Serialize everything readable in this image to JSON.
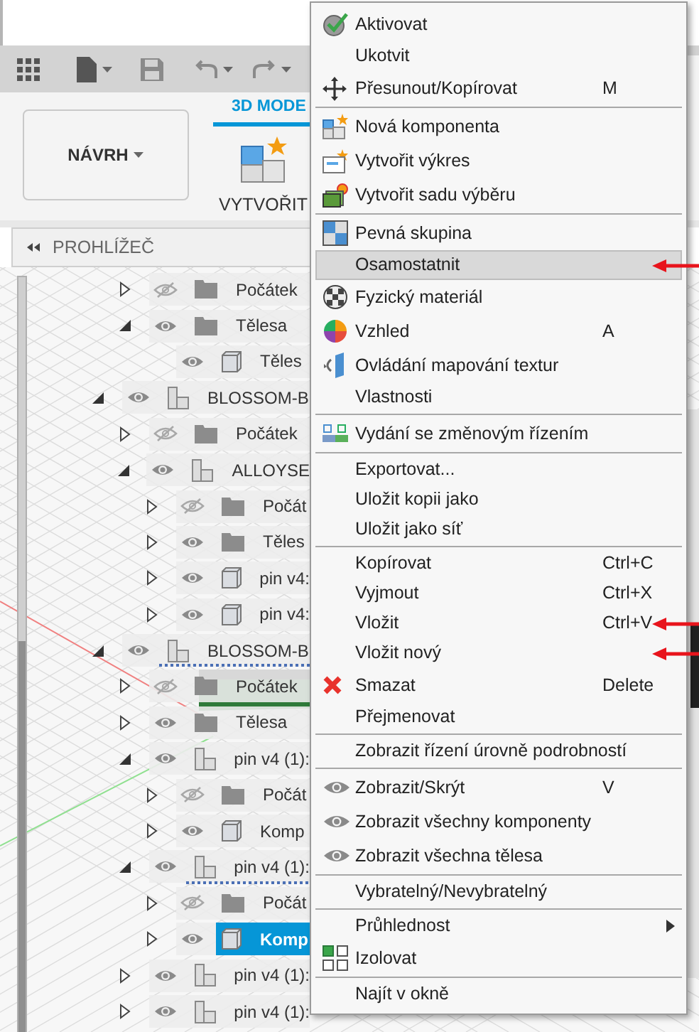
{
  "ribbon": {
    "workspace": "NÁVRH",
    "tabs": [
      {
        "label": "3D MODE",
        "selected": true
      }
    ],
    "tools": [
      {
        "label": "VYTVOŘIT"
      }
    ]
  },
  "browser": {
    "title": "PROHLÍŽEČ",
    "tree": [
      {
        "children": [
          {
            "label": "Počátek",
            "kind": "folder",
            "visible": false,
            "expanded": false,
            "linked": false,
            "selected": false
          },
          {
            "label": "Tělesa",
            "kind": "folder",
            "visible": true,
            "expanded": true,
            "linked": false,
            "selected": false,
            "children": [
              {
                "label": "Těles",
                "kind": "body",
                "visible": true,
                "linked": false,
                "selected": false
              }
            ]
          }
        ]
      },
      {
        "label": "BLOSSOM-B",
        "kind": "component",
        "visible": true,
        "expanded": true,
        "linked": false,
        "selected": false,
        "children": [
          {
            "label": "Počátek",
            "kind": "folder",
            "visible": false,
            "expanded": false,
            "linked": false,
            "selected": false
          },
          {
            "label": "ALLOYSE",
            "kind": "component",
            "visible": true,
            "expanded": true,
            "linked": false,
            "selected": false,
            "children": [
              {
                "label": "Počát",
                "kind": "folder",
                "visible": false,
                "expanded": false,
                "linked": false,
                "selected": false
              },
              {
                "label": "Těles",
                "kind": "folder",
                "visible": true,
                "expanded": false,
                "linked": false,
                "selected": false
              },
              {
                "label": "pin v4:",
                "kind": "body",
                "visible": true,
                "expanded": false,
                "linked": false,
                "selected": false
              },
              {
                "label": "pin v4:",
                "kind": "body",
                "visible": true,
                "expanded": false,
                "linked": false,
                "selected": false
              }
            ]
          }
        ]
      },
      {
        "label": "BLOSSOM-B",
        "kind": "component",
        "visible": true,
        "expanded": true,
        "linked": true,
        "selected": false,
        "children": [
          {
            "label": "Počátek",
            "kind": "folder",
            "visible": false,
            "expanded": false,
            "linked": false,
            "selected": false
          },
          {
            "label": "Tělesa",
            "kind": "folder",
            "visible": true,
            "expanded": false,
            "linked": false,
            "selected": false
          },
          {
            "label": "pin v4 (1):",
            "kind": "component",
            "visible": true,
            "expanded": true,
            "linked": false,
            "selected": false,
            "children": [
              {
                "label": "Počát",
                "kind": "folder",
                "visible": false,
                "expanded": false,
                "linked": false,
                "selected": false
              },
              {
                "label": "Komp",
                "kind": "body",
                "visible": true,
                "expanded": false,
                "linked": false,
                "selected": false
              }
            ]
          },
          {
            "label": "pin v4 (1):",
            "kind": "component",
            "visible": true,
            "expanded": true,
            "linked": true,
            "selected": false,
            "children": [
              {
                "label": "Počát",
                "kind": "folder",
                "visible": false,
                "expanded": false,
                "linked": false,
                "selected": false
              },
              {
                "label": "Komp",
                "kind": "body",
                "visible": true,
                "expanded": false,
                "linked": false,
                "selected": true
              }
            ]
          },
          {
            "label": "pin v4 (1):",
            "kind": "component",
            "visible": true,
            "expanded": false,
            "linked": false,
            "selected": false
          },
          {
            "label": "pin v4 (1):",
            "kind": "component",
            "visible": true,
            "expanded": false,
            "linked": false,
            "selected": false
          }
        ]
      }
    ]
  },
  "context_menu": {
    "sections": [
      {
        "items": [
          {
            "label": "Aktivovat",
            "selected": false,
            "marked": false
          },
          {
            "label": "Ukotvit",
            "selected": false,
            "marked": false
          },
          {
            "label": "Přesunout/Kopírovat",
            "shortcut": "M",
            "selected": false,
            "marked": false
          }
        ]
      },
      {
        "items": [
          {
            "label": "Nová komponenta",
            "selected": false,
            "marked": false
          },
          {
            "label": "Vytvořit výkres",
            "selected": false,
            "marked": false
          },
          {
            "label": "Vytvořit sadu výběru",
            "selected": false,
            "marked": false
          }
        ]
      },
      {
        "items": [
          {
            "label": "Pevná skupina",
            "selected": false,
            "marked": false
          },
          {
            "label": "Osamostatnit",
            "selected": true,
            "marked": true
          },
          {
            "label": "Fyzický materiál",
            "selected": false,
            "marked": false
          },
          {
            "label": "Vzhled",
            "shortcut": "A",
            "selected": false,
            "marked": false
          },
          {
            "label": "Ovládání mapování textur",
            "selected": false,
            "marked": false
          },
          {
            "label": "Vlastnosti",
            "selected": false,
            "marked": false
          }
        ]
      },
      {
        "items": [
          {
            "label": "Vydání se změnovým řízením",
            "selected": false,
            "marked": false
          }
        ]
      },
      {
        "items": [
          {
            "label": "Exportovat...",
            "selected": false,
            "marked": false
          },
          {
            "label": "Uložit kopii jako",
            "selected": false,
            "marked": false
          },
          {
            "label": "Uložit jako síť",
            "selected": false,
            "marked": false
          }
        ]
      },
      {
        "items": [
          {
            "label": "Kopírovat",
            "shortcut": "Ctrl+C",
            "selected": false,
            "marked": false
          },
          {
            "label": "Vyjmout",
            "shortcut": "Ctrl+X",
            "selected": false,
            "marked": false
          },
          {
            "label": "Vložit",
            "shortcut": "Ctrl+V",
            "selected": false,
            "marked": true
          },
          {
            "label": "Vložit nový",
            "selected": false,
            "marked": true
          },
          {
            "label": "Smazat",
            "shortcut": "Delete",
            "selected": false,
            "marked": false
          },
          {
            "label": "Přejmenovat",
            "selected": false,
            "marked": false
          }
        ]
      },
      {
        "items": [
          {
            "label": "Zobrazit řízení úrovně podrobností",
            "selected": false,
            "marked": false
          }
        ]
      },
      {
        "items": [
          {
            "label": "Zobrazit/Skrýt",
            "shortcut": "V",
            "selected": false,
            "marked": false
          },
          {
            "label": "Zobrazit všechny komponenty",
            "selected": false,
            "marked": false
          },
          {
            "label": "Zobrazit všechna tělesa",
            "selected": false,
            "marked": false
          }
        ]
      },
      {
        "items": [
          {
            "label": "Vybratelný/Nevybratelný",
            "selected": false,
            "marked": false
          }
        ]
      },
      {
        "items": [
          {
            "label": "Průhlednost",
            "has_submenu": true,
            "selected": false,
            "marked": false
          },
          {
            "label": "Izolovat",
            "selected": false,
            "marked": false
          }
        ]
      },
      {
        "items": [
          {
            "label": "Najít v okně",
            "selected": false,
            "marked": false
          }
        ]
      }
    ]
  }
}
